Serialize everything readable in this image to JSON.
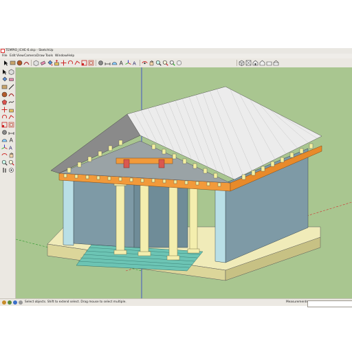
{
  "window": {
    "title": "TEMPIO_ICHE-6.skp - SketchUp"
  },
  "menu": {
    "items": [
      "File",
      "Edit",
      "View",
      "Camera",
      "Draw",
      "Tools",
      "Window",
      "Help"
    ]
  },
  "toolbar": {
    "icons": [
      "select-icon",
      "rectangle-icon",
      "circle-icon",
      "arc-icon",
      "make-component-icon",
      "eraser-icon",
      "paint-bucket-icon",
      "push-pull-icon",
      "move-icon",
      "rotate-icon",
      "follow-me-icon",
      "scale-icon",
      "offset-icon",
      "tape-measure-icon",
      "dimension-icon",
      "protractor-icon",
      "text-icon",
      "axes-icon",
      "3d-text-icon",
      "orbit-icon",
      "pan-icon",
      "zoom-icon",
      "zoom-window-icon",
      "zoom-extents-icon",
      "previous-view-icon",
      "next-view-icon",
      "get-models-icon",
      "share-model-icon",
      "component-icon",
      "iso-view-icon",
      "top-view-icon",
      "front-view-icon",
      "right-view-icon",
      "back-view-icon",
      "left-view-icon"
    ]
  },
  "status": {
    "hint": "Select objects. Shift to extend select. Drag mouse to select multiple.",
    "measurements_label": "Measurements",
    "measurements_value": ""
  },
  "colors": {
    "sky": "#a9c690",
    "wall": "#7e9aa6",
    "wall_light": "#b9dfe6",
    "column": "#f4eeae",
    "roof": "#ececec",
    "beam": "#f29a3a",
    "step": "#6cc4b4",
    "axis_blue": "#2b3bd0",
    "axis_red": "#d03030"
  }
}
